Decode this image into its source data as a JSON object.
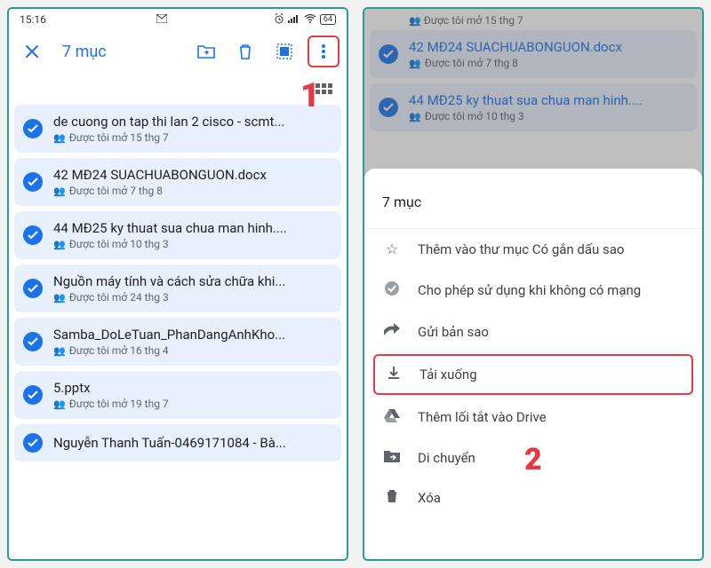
{
  "statusbar": {
    "time": "15:16",
    "battery": "64"
  },
  "toolbar": {
    "title": "7 mục"
  },
  "annotations": {
    "one": "1",
    "two": "2"
  },
  "files": [
    {
      "title": "de cuong on tap thi lan 2 cisco - scmt...",
      "sub": "Được tôi mở 15 thg 7"
    },
    {
      "title": "42 MĐ24 SUACHUABONGUON.docx",
      "sub": "Được tôi mở 7 thg 8"
    },
    {
      "title": "44 MĐ25 ky thuat sua chua man hinh....",
      "sub": "Được tôi mở 10 thg 3"
    },
    {
      "title": "Nguồn máy tính và cách sửa chữa khi...",
      "sub": "Được tôi mở 24 thg 3"
    },
    {
      "title": "Samba_DoLeTuan_PhanDangAnhKho...",
      "sub": "Được tôi mở 16 thg 4"
    },
    {
      "title": "5.pptx",
      "sub": "Được tôi mở 19 thg 7"
    },
    {
      "title": "Nguyễn Thanh Tuấn-0469171084 - Bà...",
      "sub": ""
    }
  ],
  "faded_top_sub": "Được tôi mở 15 thg 7",
  "faded_files": [
    {
      "title": "42 MĐ24 SUACHUABONGUON.docx",
      "sub": "Được tôi mở 7 thg 8"
    },
    {
      "title": "44 MĐ25 ky thuat sua chua man hinh....",
      "sub": "Được tôi mở 10 thg 3"
    }
  ],
  "sheet": {
    "title": "7 mục",
    "items": {
      "star": "Thêm vào thư mục Có gắn dấu sao",
      "offline": "Cho phép sử dụng khi không có mạng",
      "send": "Gửi bản sao",
      "download": "Tải xuống",
      "shortcut": "Thêm lối tắt vào Drive",
      "move": "Di chuyển",
      "delete": "Xóa"
    }
  }
}
